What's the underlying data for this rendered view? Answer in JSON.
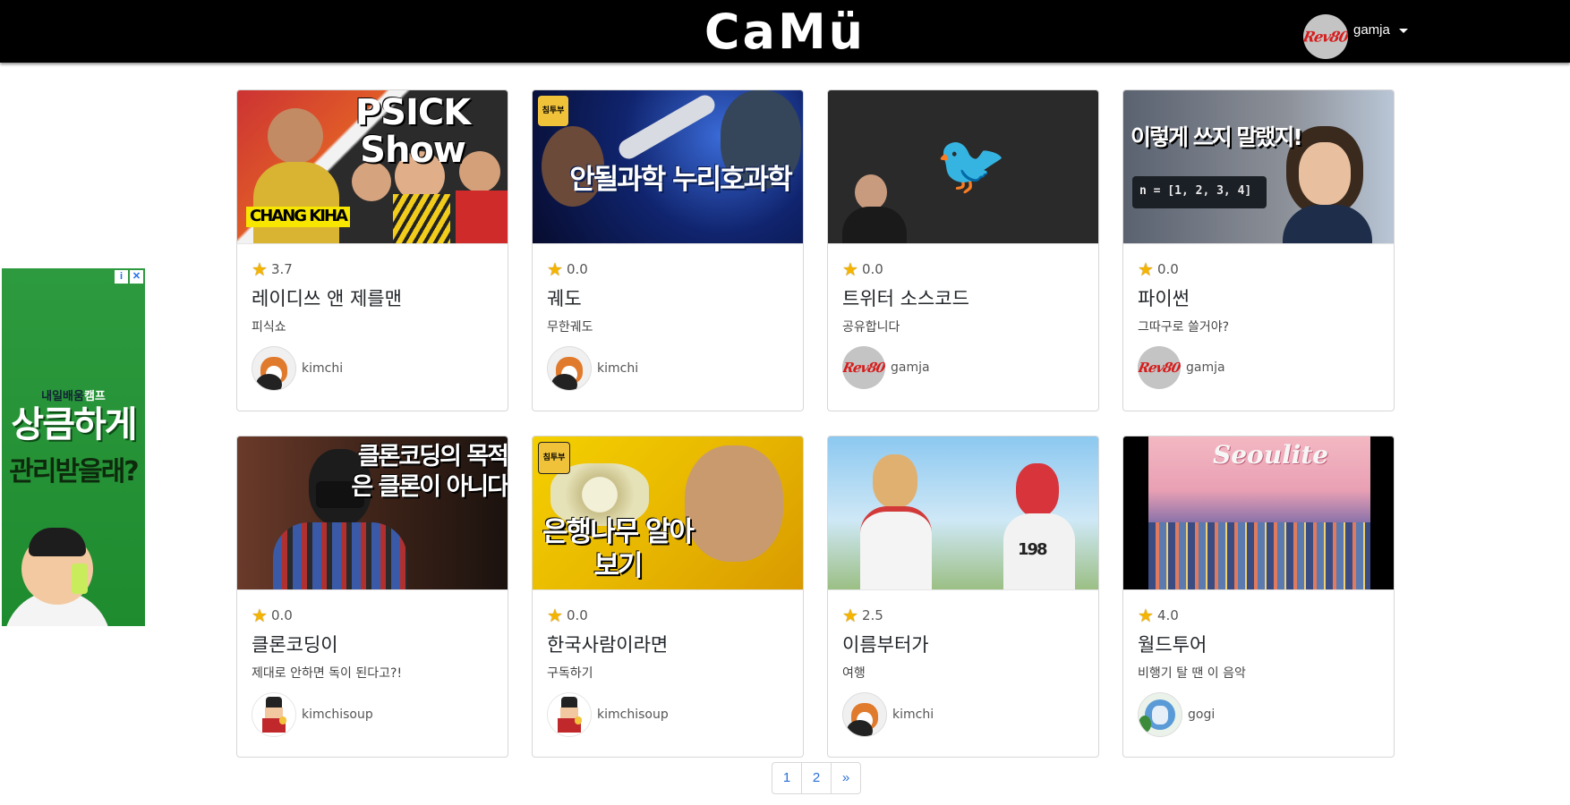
{
  "header": {
    "brand": "CaMü",
    "user": {
      "avatar_text": "Rev80",
      "name": "gamja"
    }
  },
  "ad": {
    "brand_prefix": "내일배움",
    "brand_highlight": "캠프",
    "headline": "상큼하게",
    "subline": "관리받을래?"
  },
  "cards": [
    {
      "rating": "3.7",
      "title": "레이디쓰 앤 제를맨",
      "description": "피식쇼",
      "author": "kimchi",
      "avatar": "shiba",
      "thumb_text": "PSICK Show",
      "thumb_sub": "CHANG KIHA"
    },
    {
      "rating": "0.0",
      "title": "궤도",
      "description": "무한궤도",
      "author": "kimchi",
      "avatar": "shiba",
      "thumb_text": "안될과학 누리호과학",
      "thumb_sub": "침투부"
    },
    {
      "rating": "0.0",
      "title": "트위터 소스코드",
      "description": "공유합니다",
      "author": "gamja",
      "avatar": "rev",
      "thumb_text": "",
      "thumb_sub": ""
    },
    {
      "rating": "0.0",
      "title": "파이썬",
      "description": "그따구로 쓸거야?",
      "author": "gamja",
      "avatar": "rev",
      "thumb_text": "이렇게 쓰지 말랬지!",
      "thumb_sub": "n = [1, 2, 3, 4]"
    },
    {
      "rating": "0.0",
      "title": "클론코딩이",
      "description": "제대로 안하면 독이 된다고?!",
      "author": "kimchisoup",
      "avatar": "warrior",
      "thumb_text": "클론코딩의 목적은 클론이 아니다",
      "thumb_sub": ""
    },
    {
      "rating": "0.0",
      "title": "한국사람이라면",
      "description": "구독하기",
      "author": "kimchisoup",
      "avatar": "warrior",
      "thumb_text": "은행나무 알아보기",
      "thumb_sub": "침투부"
    },
    {
      "rating": "2.5",
      "title": "이름부터가",
      "description": "여행",
      "author": "kimchi",
      "avatar": "shiba",
      "thumb_text": "",
      "thumb_sub": "198"
    },
    {
      "rating": "4.0",
      "title": "월드투어",
      "description": "비행기 탈 땐 이 음악",
      "author": "gogi",
      "avatar": "gogi",
      "thumb_text": "Seoulite",
      "thumb_sub": ""
    }
  ],
  "pagination": {
    "pages": [
      "1",
      "2"
    ],
    "next": "»"
  },
  "colors": {
    "navbar": "#000000",
    "link": "#2b6fd6",
    "star": "#f5b400",
    "ad_green": "#1f8b2f"
  }
}
